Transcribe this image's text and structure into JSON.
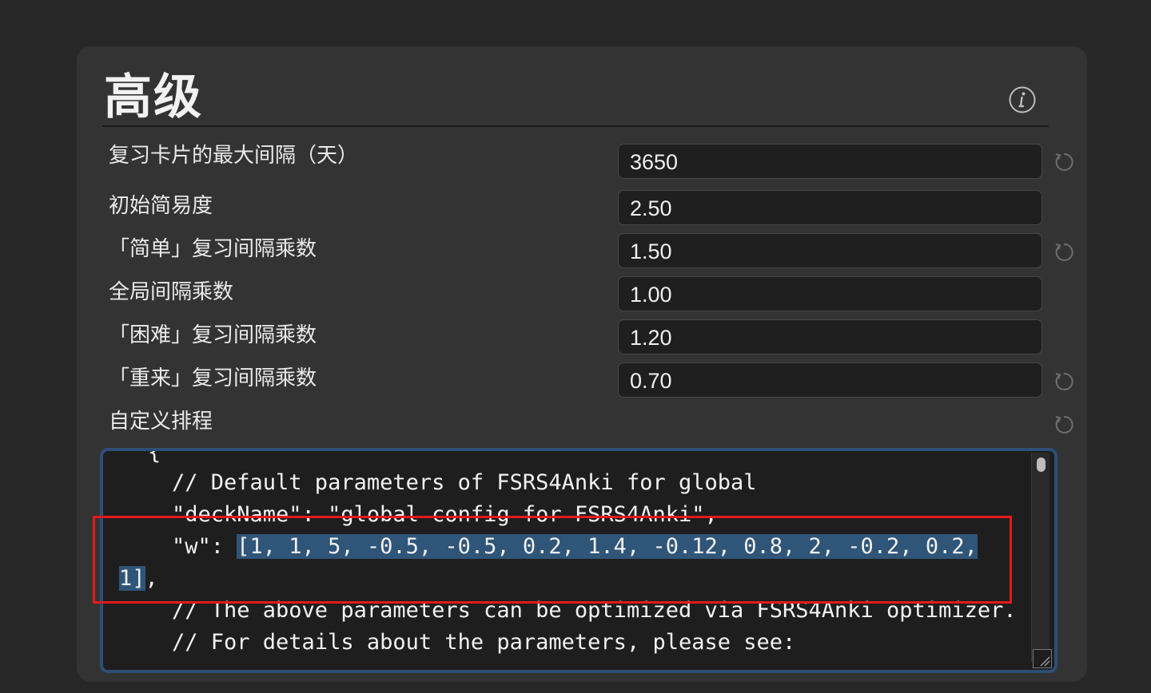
{
  "section": {
    "title": "高级",
    "info_icon": "info-icon"
  },
  "settings": [
    {
      "label": "复习卡片的最大间隔（天）",
      "value": "3650",
      "has_reset": true
    },
    {
      "label": "初始简易度",
      "value": "2.50",
      "has_reset": false
    },
    {
      "label": "「简单」复习间隔乘数",
      "value": "1.50",
      "has_reset": true
    },
    {
      "label": "全局间隔乘数",
      "value": "1.00",
      "has_reset": false
    },
    {
      "label": "「困难」复习间隔乘数",
      "value": "1.20",
      "has_reset": false
    },
    {
      "label": "「重来」复习间隔乘数",
      "value": "0.70",
      "has_reset": true
    }
  ],
  "custom_scheduling": {
    "label": "自定义排程",
    "has_reset": true,
    "code_lines": [
      "{",
      "// Default parameters of FSRS4Anki for global",
      "\"deckName\": \"global config for FSRS4Anki\",",
      "\"w\": ",
      "[1, 1, 5, -0.5, -0.5, 0.2, 1.4, -0.12, 0.8, 2, -0.2, 0.2,",
      "1]",
      ",",
      "// The above parameters can be optimized via FSRS4Anki optimizer.",
      "// For details about the parameters, please see:"
    ]
  },
  "colors": {
    "panel": "#333333",
    "selection": "#2f5578",
    "focus_border": "#2d4f77",
    "annotation": "#e21a1a"
  }
}
